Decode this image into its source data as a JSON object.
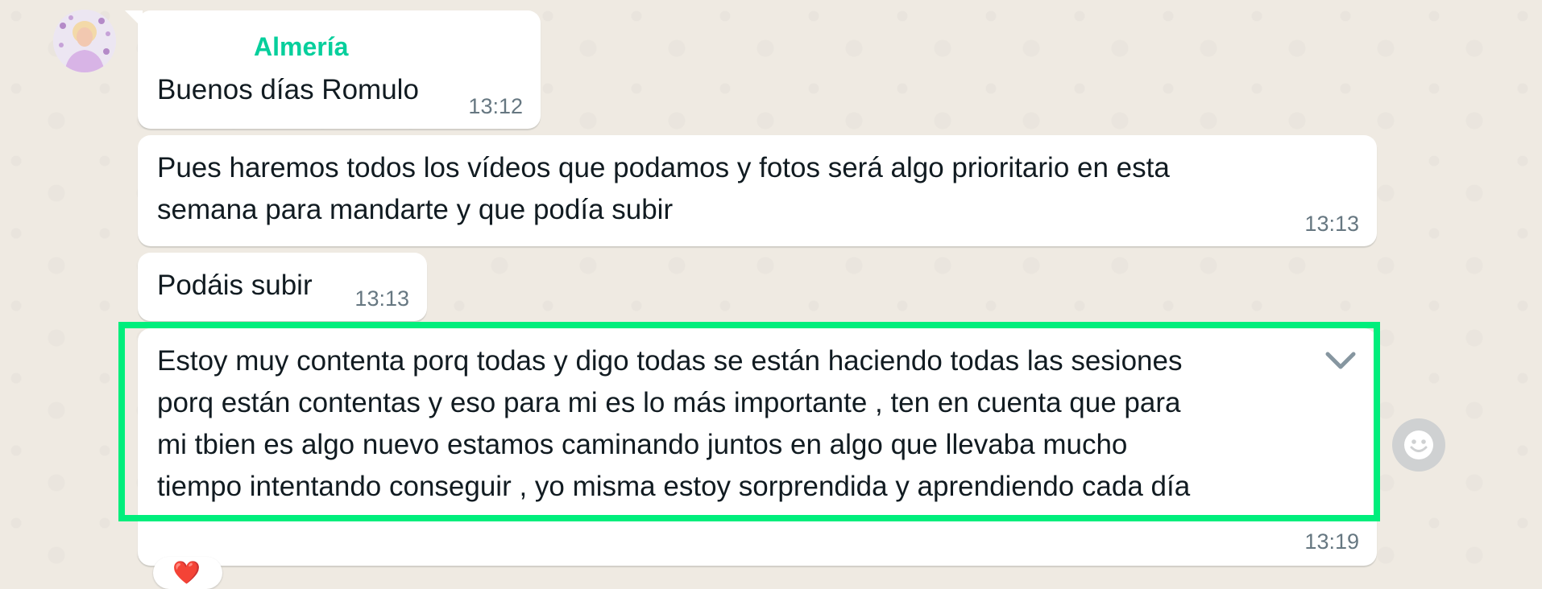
{
  "chat": {
    "sender_name": "Almería",
    "messages": [
      {
        "text": "Buenos días Romulo",
        "time": "13:12"
      },
      {
        "lines": [
          "Pues haremos todos los vídeos que podamos y fotos será algo prioritario en esta",
          "semana para mandarte y que podía subir"
        ],
        "time": "13:13"
      },
      {
        "text": "Podáis subir",
        "time": "13:13"
      },
      {
        "lines": [
          "Estoy muy contenta porq todas y digo todas se están haciendo todas las sesiones",
          "porq están contentas y eso para mi es lo más importante , ten en cuenta que para",
          "mi tbien es algo nuevo estamos caminando juntos en algo que llevaba mucho",
          "tiempo intentando conseguir , yo misma estoy sorprendida y aprendiendo cada día"
        ],
        "time": "13:19"
      }
    ],
    "reaction_emoji": "❤️"
  },
  "icons": {
    "message_menu": "chevron-down-icon",
    "react": "smiley-icon"
  },
  "colors": {
    "background": "#efeae2",
    "bubble": "#ffffff",
    "sender_name": "#06cf9c",
    "timestamp": "#667781",
    "highlight": "#00ee7c",
    "emoji_button": "#cfd1d2"
  }
}
